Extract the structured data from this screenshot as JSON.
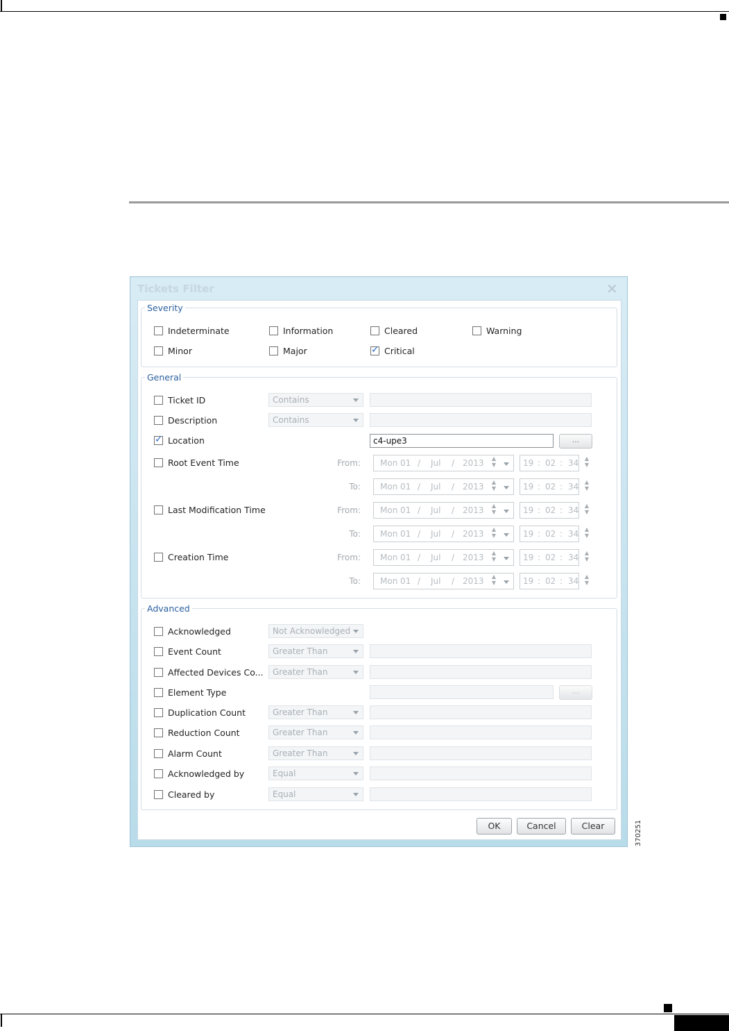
{
  "dialog": {
    "title": "Tickets Filter",
    "close_glyph": "✕",
    "figure_id": "370251"
  },
  "severity": {
    "legend": "Severity",
    "items": [
      {
        "label": "Indeterminate",
        "checked": false
      },
      {
        "label": "Information",
        "checked": false
      },
      {
        "label": "Cleared",
        "checked": false
      },
      {
        "label": "Warning",
        "checked": false
      },
      {
        "label": "Minor",
        "checked": false
      },
      {
        "label": "Major",
        "checked": false
      },
      {
        "label": "Critical",
        "checked": true
      }
    ]
  },
  "general": {
    "legend": "General",
    "ticket_id": {
      "label": "Ticket ID",
      "operator": "Contains"
    },
    "description": {
      "label": "Description",
      "operator": "Contains"
    },
    "location": {
      "label": "Location",
      "value": "c4-upe3",
      "button": "..."
    },
    "root_event_time": {
      "label": "Root Event Time"
    },
    "last_modification_time": {
      "label": "Last Modification Time"
    },
    "creation_time": {
      "label": "Creation Time"
    },
    "from_label": "From:",
    "to_label": "To:",
    "date": {
      "day": "Mon",
      "date": "01",
      "sep": "/",
      "month": "Jul",
      "year": "2013"
    },
    "time": {
      "h": "19",
      "m": "02",
      "s": "34",
      "sep": ":"
    }
  },
  "advanced": {
    "legend": "Advanced",
    "acknowledged": {
      "label": "Acknowledged",
      "operator": "Not Acknowledged"
    },
    "event_count": {
      "label": "Event Count",
      "operator": "Greater Than"
    },
    "affected_devices": {
      "label": "Affected Devices Co...",
      "operator": "Greater Than"
    },
    "element_type": {
      "label": "Element Type",
      "button": "..."
    },
    "duplication_count": {
      "label": "Duplication Count",
      "operator": "Greater Than"
    },
    "reduction_count": {
      "label": "Reduction Count",
      "operator": "Greater Than"
    },
    "alarm_count": {
      "label": "Alarm Count",
      "operator": "Greater Than"
    },
    "acknowledged_by": {
      "label": "Acknowledged by",
      "operator": "Equal"
    },
    "cleared_by": {
      "label": "Cleared by",
      "operator": "Equal"
    }
  },
  "buttons": {
    "ok": "OK",
    "cancel": "Cancel",
    "clear": "Clear"
  }
}
